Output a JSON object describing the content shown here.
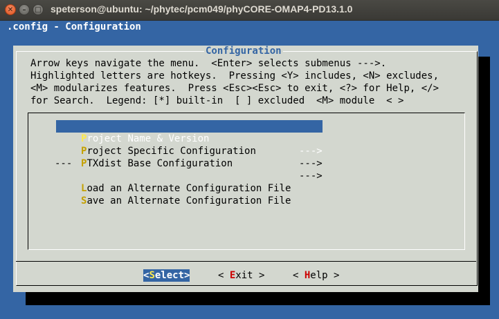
{
  "window": {
    "title": "speterson@ubuntu: ~/phytec/pcm049/phyCORE-OMAP4-PD13.1.0",
    "close_glyph": "✕",
    "min_glyph": "–",
    "max_glyph": "□"
  },
  "topbar": {
    "text": ".config - Configuration"
  },
  "dialog": {
    "title": "Configuration",
    "help_lines": [
      "Arrow keys navigate the menu.  <Enter> selects submenus --->.",
      "Highlighted letters are hotkeys.  Pressing <Y> includes, <N> excludes,",
      "<M> modularizes features.  Press <Esc><Esc> to exit, <?> for Help, </>",
      "for Search.  Legend: [*] built-in  [ ] excluded  <M> module  < >"
    ],
    "menu": [
      {
        "hotkey": "P",
        "rest": "roject Name & Version",
        "arrow": "--->",
        "selected": true
      },
      {
        "hotkey": "P",
        "rest": "roject Specific Configuration",
        "arrow": "--->",
        "selected": false
      },
      {
        "hotkey": "P",
        "rest": "TXdist Base Configuration",
        "arrow": "--->",
        "selected": false
      },
      {
        "hotkey": "L",
        "rest": "oad an Alternate Configuration File",
        "arrow": "",
        "selected": false
      },
      {
        "hotkey": "S",
        "rest": "ave an Alternate Configuration File",
        "arrow": "",
        "selected": false
      }
    ],
    "separator": "---",
    "buttons": {
      "select": {
        "pre": "<",
        "hot": "S",
        "post": "elect>"
      },
      "exit": {
        "pre": "< ",
        "hot": "E",
        "post": "xit >"
      },
      "help": {
        "pre": "< ",
        "hot": "H",
        "post": "elp >"
      }
    }
  }
}
